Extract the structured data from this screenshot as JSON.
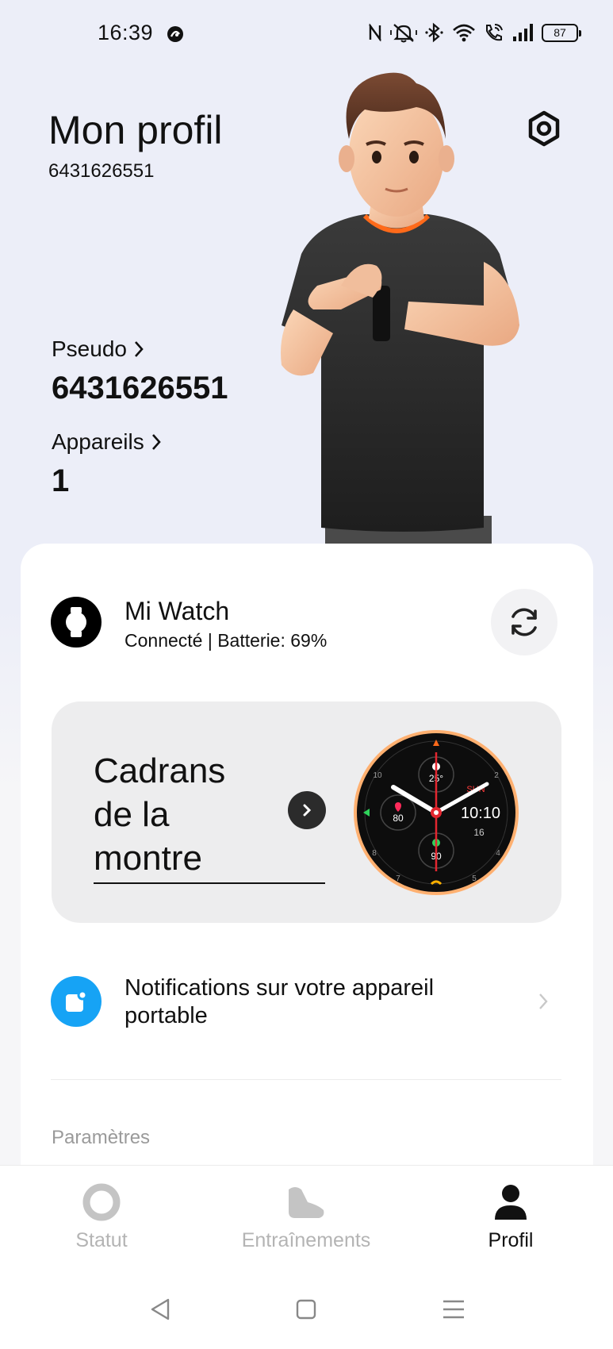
{
  "status_bar": {
    "time": "16:39",
    "battery": "87",
    "icons": [
      "nfc-icon",
      "mute-icon",
      "bluetooth-icon",
      "wifi-icon",
      "wifi-calling-icon",
      "signal-icon",
      "battery-icon"
    ]
  },
  "header": {
    "title": "Mon profil",
    "user_id": "6431626551",
    "settings_icon": "gear-icon"
  },
  "profile": {
    "nickname_label": "Pseudo",
    "nickname_value": "6431626551",
    "devices_label": "Appareils",
    "devices_value": "1"
  },
  "device": {
    "name": "Mi Watch",
    "status": "Connecté | Batterie: 69%",
    "battery_level": 0.69,
    "sync_icon": "sync-icon"
  },
  "watchfaces": {
    "title": "Cadrans de la montre",
    "preview": {
      "time": "10:10",
      "temperature": "25°",
      "heart_rate": "80",
      "score": "90",
      "date": "16",
      "day": "SUN",
      "dial_numbers": [
        "10",
        "2",
        "8",
        "4",
        "7",
        "5"
      ]
    }
  },
  "notifications": {
    "label": "Notifications sur votre appareil portable"
  },
  "section": {
    "label": "Paramètres"
  },
  "bottom_nav": {
    "items": [
      {
        "label": "Statut",
        "icon": "status-ring-icon",
        "active": false
      },
      {
        "label": "Entraînements",
        "icon": "shoe-icon",
        "active": false
      },
      {
        "label": "Profil",
        "icon": "person-icon",
        "active": true
      }
    ]
  },
  "colors": {
    "background": "#eceef8",
    "card": "#ffffff",
    "accent_blue": "#16a3f5",
    "inactive": "#b4b4b4",
    "active": "#111111"
  }
}
